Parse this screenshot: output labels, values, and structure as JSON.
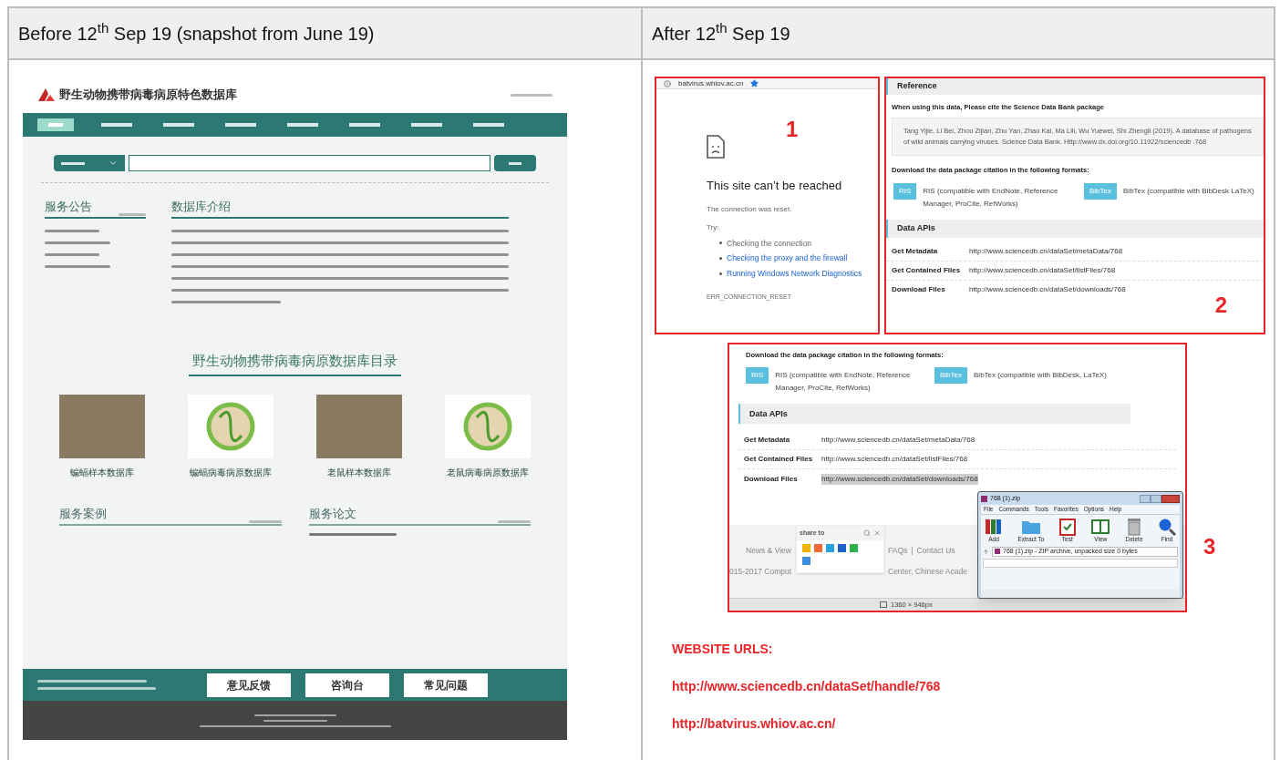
{
  "document_table": {
    "columns": [
      {
        "header": "Before 12$^{th}$ Sep 19 (snapshot from June 19)"
      },
      {
        "header": "After 12$^{th}$ Sep 19"
      }
    ]
  },
  "before_snapshot": {
    "site_title": "野生动物携带病毒病原特色数据库",
    "nav_items": [
      {
        "selected": true
      },
      {
        "selected": false
      },
      {
        "selected": false
      },
      {
        "selected": false
      },
      {
        "selected": false
      },
      {
        "selected": false
      },
      {
        "selected": false
      },
      {
        "selected": false
      }
    ],
    "sections": [
      {
        "title": "服务公告"
      },
      {
        "title": "数据库介绍"
      }
    ],
    "catalogue_title": "野生动物携带病毒病原数据库目录",
    "catalogue": [
      {
        "kind": "photo",
        "caption": "蝙蝠样本数据库"
      },
      {
        "kind": "diagram",
        "caption": "蝙蝠病毒病原数据库"
      },
      {
        "kind": "photo",
        "caption": "老鼠样本数据库"
      },
      {
        "kind": "diagram",
        "caption": "老鼠病毒病原数据库"
      }
    ],
    "lower_sections": [
      {
        "title": "服务案例"
      },
      {
        "title": "服务论文"
      }
    ],
    "footer_logos": [
      {
        "text": "意见反馈"
      },
      {
        "text": "咨询台"
      },
      {
        "text": "常见问题"
      }
    ]
  },
  "after_panels": {
    "error_page": {
      "marker": "1",
      "url": "batvirus.whiov.ac.cn",
      "title": "This site can’t be reached",
      "message": "The connection was reset.",
      "try_label": "Try:",
      "suggestions": [
        {
          "text": "Checking the connection",
          "link": false
        },
        {
          "text": "Checking the proxy and the firewall",
          "link": true
        },
        {
          "text": "Running Windows Network Diagnostics",
          "link": true
        }
      ],
      "code": "ERR_CONNECTION_RESET"
    },
    "dataset_page": {
      "marker": "2",
      "reference_heading": "Reference",
      "cite_instruction": "When using this data, Please cite the Science Data Bank package",
      "citation": "Tang Yijie, Li Bei, Zhou Zijian, Zhu Yan, Zhao Kai, Ma Lili, Wu Yuewei, Shi Zhengli (2019). A database of pathogens of wild animals carrying viruses. Science Data Bank. Http://www.dx.doi.org/10.11922/sciencedb .768",
      "formats_heading": "Download the data package citation in the following formats:",
      "formats": [
        {
          "button": "RIS",
          "description": "RIS (compatible with EndNote, Reference Manager, ProCite, RefWorks)"
        },
        {
          "button": "BibTex",
          "description": "BibTex (compatible with BibDesk LaTeX)"
        }
      ],
      "apis_heading": "Data APIs",
      "apis": [
        {
          "label": "Get Metadata",
          "url": "http://www.sciencedb.cn/dataSet/metaData/768",
          "selected": false
        },
        {
          "label": "Get Contained Files",
          "url": "http://www.sciencedb.cn/dataSet/listFiles/768",
          "selected": false
        },
        {
          "label": "Download Files",
          "url": "http://www.sciencedb.cn/dataSet/downloads/768",
          "selected": false
        }
      ]
    },
    "download_page": {
      "marker": "3",
      "formats_heading": "Download the data package citation in the following formats:",
      "formats": [
        {
          "button": "RIS",
          "description": "RIS (compatible with EndNote, Reference Manager, ProCite, RefWorks)"
        },
        {
          "button": "BibTex",
          "description": "BibTex (compatible with BibDesk, LaTeX)"
        }
      ],
      "apis_heading": "Data APIs",
      "apis": [
        {
          "label": "Get Metadata",
          "url": "http://www.sciencedb.cn/dataSet/metaData/768",
          "selected": false
        },
        {
          "label": "Get Contained Files",
          "url": "http://www.sciencedb.cn/dataSet/listFiles/768",
          "selected": false
        },
        {
          "label": "Download Files",
          "url": "http://www.sciencedb.cn/dataSet/downloads/768",
          "selected": true
        }
      ],
      "share_popup": {
        "title": "share to"
      },
      "footer_fragments": [
        {
          "text": "News & View"
        },
        {
          "text": "FAQs"
        },
        {
          "text": "|"
        },
        {
          "text": "Contact Us"
        },
        {
          "text": "015-2017 Comput"
        },
        {
          "text": "Center, Chinese Acade"
        }
      ],
      "status_size": "1360 × 946px",
      "archive_window": {
        "title": "768 (1).zip",
        "menu": [
          "File",
          "Commands",
          "Tools",
          "Favorites",
          "Options",
          "Help"
        ],
        "tools": [
          {
            "kind": "add",
            "label": "Add"
          },
          {
            "kind": "extract",
            "label": "Extract To"
          },
          {
            "kind": "test",
            "label": "Test"
          },
          {
            "kind": "view",
            "label": "View"
          },
          {
            "kind": "delete",
            "label": "Delete"
          },
          {
            "kind": "find",
            "label": "Find"
          }
        ],
        "path": "768 (1).zip - ZIP archive, unpacked size 0 bytes"
      }
    }
  },
  "website_urls": {
    "heading": "WEBSITE URLS:",
    "urls": [
      "http://www.sciencedb.cn/dataSet/handle/768",
      "http://batvirus.whiov.ac.cn/"
    ]
  }
}
